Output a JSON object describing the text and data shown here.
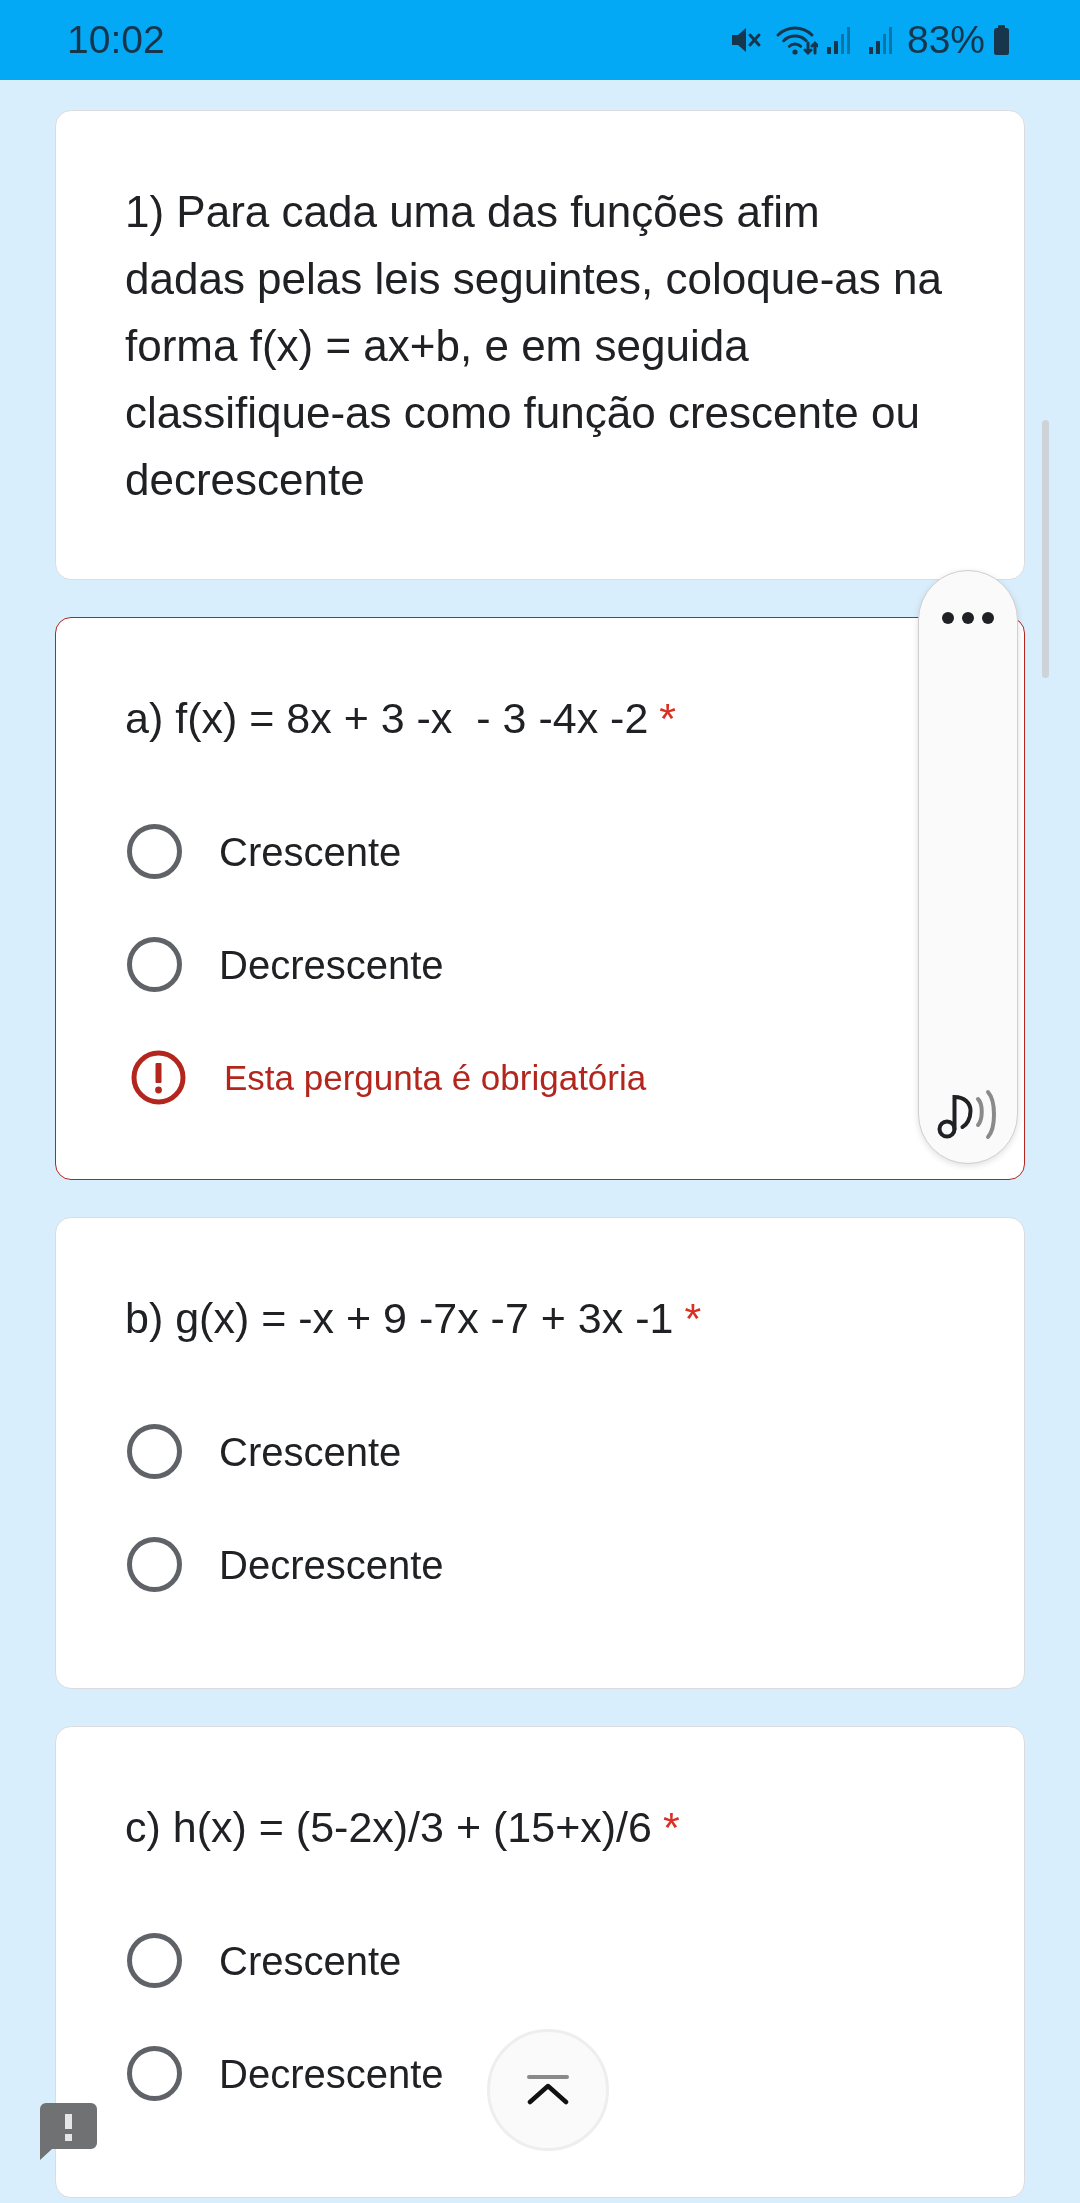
{
  "status_bar": {
    "time": "10:02",
    "battery": "83%"
  },
  "intro": {
    "text": "1) Para cada uma das funções afim dadas pelas leis seguintes, coloque-as na forma f(x) = ax+b, e em seguida classifique-as como função crescente ou decrescente"
  },
  "questions": [
    {
      "title": "a) f(x) = 8x + 3 -x  - 3 -4x -2",
      "required_mark": "*",
      "options": [
        {
          "label": "Crescente",
          "selected": false
        },
        {
          "label": "Decrescente",
          "selected": false
        }
      ],
      "error": "Esta pergunta é obrigatória"
    },
    {
      "title": "b) g(x) = -x + 9 -7x -7 + 3x -1",
      "required_mark": "*",
      "options": [
        {
          "label": "Crescente",
          "selected": false
        },
        {
          "label": "Decrescente",
          "selected": false
        }
      ]
    },
    {
      "title": "c) h(x) = (5-2x)/3 + (15+x)/6",
      "required_mark": "*",
      "options": [
        {
          "label": "Crescente",
          "selected": false
        },
        {
          "label": "Decrescente",
          "selected": false
        }
      ]
    }
  ]
}
